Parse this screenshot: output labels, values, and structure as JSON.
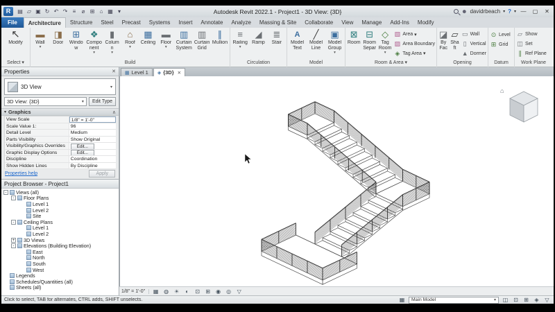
{
  "titlebar": {
    "title": "Autodesk Revit 2022.1 - Project1 - 3D View: {3D}",
    "user": "davidrbeach"
  },
  "ribbon": {
    "tabs": [
      "File",
      "Architecture",
      "Structure",
      "Steel",
      "Precast",
      "Systems",
      "Insert",
      "Annotate",
      "Analyze",
      "Massing & Site",
      "Collaborate",
      "View",
      "Manage",
      "Add-Ins",
      "Modify"
    ],
    "active_tab": "Architecture",
    "panels": [
      {
        "label": "Select ▾",
        "buttons": [
          {
            "label": "Modify"
          }
        ]
      },
      {
        "label": "Build",
        "buttons": [
          {
            "label": "Wall"
          },
          {
            "label": "Door"
          },
          {
            "label": "Window"
          },
          {
            "label": "Component"
          },
          {
            "label": "Column"
          },
          {
            "label": "Roof"
          },
          {
            "label": "Ceiling"
          },
          {
            "label": "Floor"
          },
          {
            "label": "Curtain System"
          },
          {
            "label": "Curtain Grid"
          },
          {
            "label": "Mullion"
          }
        ]
      },
      {
        "label": "Circulation",
        "buttons": [
          {
            "label": "Railing"
          },
          {
            "label": "Ramp"
          },
          {
            "label": "Stair"
          }
        ]
      },
      {
        "label": "Model",
        "buttons": [
          {
            "label": "Model Text"
          },
          {
            "label": "Model Line"
          },
          {
            "label": "Model Group"
          }
        ]
      },
      {
        "label": "Room & Area ▾",
        "buttons": [
          {
            "label": "Room"
          },
          {
            "label": "Room Separator"
          },
          {
            "label": "Tag Room"
          }
        ],
        "stack": [
          {
            "label": "Area"
          },
          {
            "label": "Area Boundary"
          },
          {
            "label": "Tag Area"
          }
        ]
      },
      {
        "label": "Opening",
        "buttons": [
          {
            "label": "By Face"
          },
          {
            "label": "Shaft"
          }
        ],
        "stack": [
          {
            "label": "Wall"
          },
          {
            "label": "Vertical"
          },
          {
            "label": "Dormer"
          }
        ]
      },
      {
        "label": "Datum",
        "stack": [
          {
            "label": "Level"
          },
          {
            "label": "Grid"
          }
        ]
      },
      {
        "label": "Work Plane",
        "stack": [
          {
            "label": "Show"
          },
          {
            "label": "Set"
          },
          {
            "label": "Ref Plane"
          }
        ]
      }
    ]
  },
  "properties": {
    "header": "Properties",
    "type_label": "3D View",
    "instance": "3D View: {3D}",
    "edit_type": "Edit Type",
    "section": "Graphics",
    "rows": [
      {
        "label": "View Scale",
        "value": "1/8\" = 1'-0\""
      },
      {
        "label": "Scale Value   1:",
        "value": "96"
      },
      {
        "label": "Detail Level",
        "value": "Medium"
      },
      {
        "label": "Parts Visibility",
        "value": "Show Original"
      },
      {
        "label": "Visibility/Graphics Overrides",
        "value": "Edit..."
      },
      {
        "label": "Graphic Display Options",
        "value": "Edit..."
      },
      {
        "label": "Discipline",
        "value": "Coordination"
      },
      {
        "label": "Show Hidden Lines",
        "value": "By Discipline"
      }
    ],
    "help": "Properties help",
    "apply": "Apply"
  },
  "browser": {
    "header": "Project Browser - Project1",
    "items": [
      {
        "exp": "-",
        "label": "Views (all)"
      },
      {
        "exp": "-",
        "label": "Floor Plans"
      },
      {
        "exp": "",
        "label": "Level 1"
      },
      {
        "exp": "",
        "label": "Level 2"
      },
      {
        "exp": "",
        "label": "Site"
      },
      {
        "exp": "-",
        "label": "Ceiling Plans"
      },
      {
        "exp": "",
        "label": "Level 1"
      },
      {
        "exp": "",
        "label": "Level 2"
      },
      {
        "exp": "+",
        "label": "3D Views"
      },
      {
        "exp": "-",
        "label": "Elevations (Building Elevation)"
      },
      {
        "exp": "",
        "label": "East"
      },
      {
        "exp": "",
        "label": "North"
      },
      {
        "exp": "",
        "label": "South"
      },
      {
        "exp": "",
        "label": "West"
      },
      {
        "exp": "",
        "label": "Legends"
      },
      {
        "exp": "",
        "label": "Schedules/Quantities (all)"
      },
      {
        "exp": "",
        "label": "Sheets (all)"
      }
    ]
  },
  "viewtabs": [
    {
      "label": "Level 1"
    },
    {
      "label": "{3D}"
    }
  ],
  "viewbar": {
    "scale": "1/8\" = 1'-0\""
  },
  "statusbar": {
    "hint": "Click to select, TAB for alternates, CTRL adds, SHIFT unselects.",
    "workset": "Main Model"
  }
}
